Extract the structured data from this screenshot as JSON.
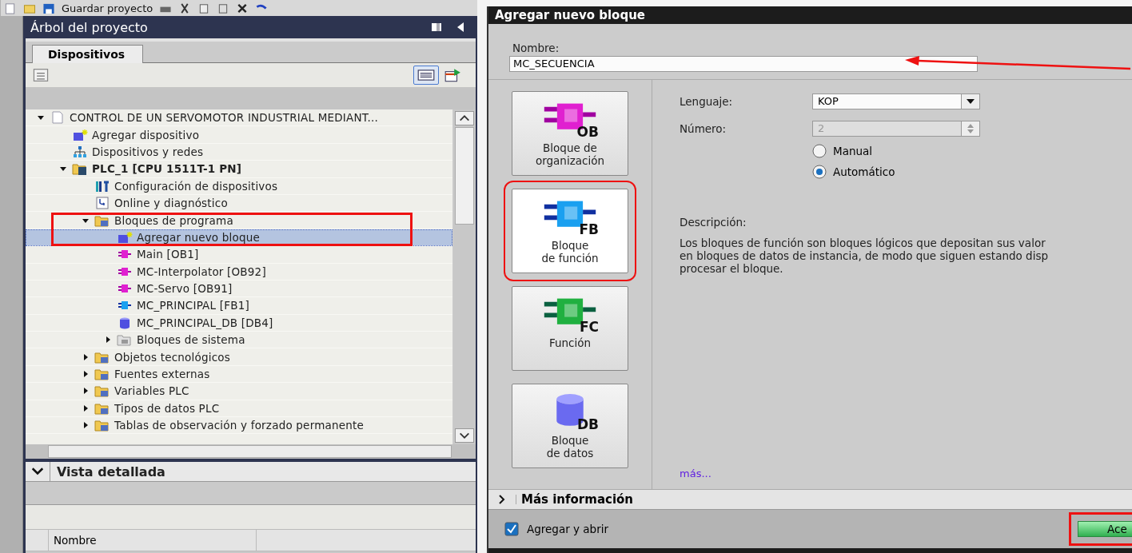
{
  "toolbar": {
    "save_label": "Guardar proyecto"
  },
  "project_tree": {
    "title": "Árbol del proyecto",
    "tabs": [
      {
        "label": "Dispositivos",
        "selected": true
      }
    ],
    "items": [
      {
        "label": "CONTROL DE UN SERVOMOTOR INDUSTRIAL MEDIANT...",
        "kind": "project",
        "expanded": true,
        "selected": false,
        "children": [
          {
            "label": "Agregar dispositivo",
            "kind": "add",
            "selected": false
          },
          {
            "label": "Dispositivos y redes",
            "kind": "network",
            "selected": false
          },
          {
            "label": "PLC_1 [CPU 1511T-1 PN]",
            "kind": "plc",
            "expanded": true,
            "selected": false,
            "children": [
              {
                "label": "Configuración de dispositivos",
                "kind": "config",
                "selected": false
              },
              {
                "label": "Online y diagnóstico",
                "kind": "diag",
                "selected": false
              },
              {
                "label": "Bloques de programa",
                "kind": "blockfolder",
                "expanded": true,
                "selected": false,
                "children": [
                  {
                    "label": "Agregar nuevo bloque",
                    "kind": "add",
                    "selected": true
                  },
                  {
                    "label": "Main [OB1]",
                    "kind": "ob",
                    "selected": false
                  },
                  {
                    "label": "MC-Interpolator [OB92]",
                    "kind": "ob",
                    "selected": false
                  },
                  {
                    "label": "MC-Servo [OB91]",
                    "kind": "ob",
                    "selected": false
                  },
                  {
                    "label": "MC_PRINCIPAL [FB1]",
                    "kind": "fb",
                    "selected": false
                  },
                  {
                    "label": "MC_PRINCIPAL_DB [DB4]",
                    "kind": "db",
                    "selected": false
                  },
                  {
                    "label": "Bloques de sistema",
                    "kind": "sysfolder",
                    "expanded": false,
                    "selected": false
                  }
                ]
              },
              {
                "label": "Objetos tecnológicos",
                "kind": "folder",
                "expanded": false,
                "selected": false
              },
              {
                "label": "Fuentes externas",
                "kind": "folder",
                "expanded": false,
                "selected": false
              },
              {
                "label": "Variables PLC",
                "kind": "folder",
                "expanded": false,
                "selected": false
              },
              {
                "label": "Tipos de datos PLC",
                "kind": "folder",
                "expanded": false,
                "selected": false
              },
              {
                "label": "Tablas de observación y forzado permanente",
                "kind": "folder",
                "expanded": false,
                "selected": false
              }
            ]
          }
        ]
      }
    ]
  },
  "detail_view": {
    "title": "Vista detallada",
    "expanded": true,
    "columns": [
      "Nombre"
    ]
  },
  "dialog": {
    "title": "Agregar nuevo bloque",
    "name_label": "Nombre:",
    "name_value": "MC_SECUENCIA",
    "block_types": [
      {
        "kind": "ob",
        "code": "OB",
        "lines": [
          "Bloque de",
          "organización"
        ],
        "selected": false
      },
      {
        "kind": "fb",
        "code": "FB",
        "lines": [
          "Bloque",
          "de función"
        ],
        "selected": true
      },
      {
        "kind": "fc",
        "code": "FC",
        "lines": [
          "Función"
        ],
        "selected": false
      },
      {
        "kind": "db",
        "code": "DB",
        "lines": [
          "Bloque",
          "de datos"
        ],
        "selected": false
      }
    ],
    "language_label": "Lenguaje:",
    "language_value": "KOP",
    "number_label": "Número:",
    "number_value": "2",
    "number_disabled": true,
    "numbering": [
      {
        "label": "Manual",
        "selected": false
      },
      {
        "label": "Automático",
        "selected": true
      }
    ],
    "description_label": "Descripción:",
    "description_lines": [
      "Los bloques de función son bloques lógicos que depositan sus valor",
      "en bloques de datos de instancia, de modo que siguen estando disp",
      "procesar el bloque."
    ],
    "more_link": "más...",
    "more_info": {
      "label": "Más información",
      "expanded": false
    },
    "add_and_open": {
      "label": "Agregar y abrir",
      "checked": true
    },
    "ok_button": "Ace"
  }
}
